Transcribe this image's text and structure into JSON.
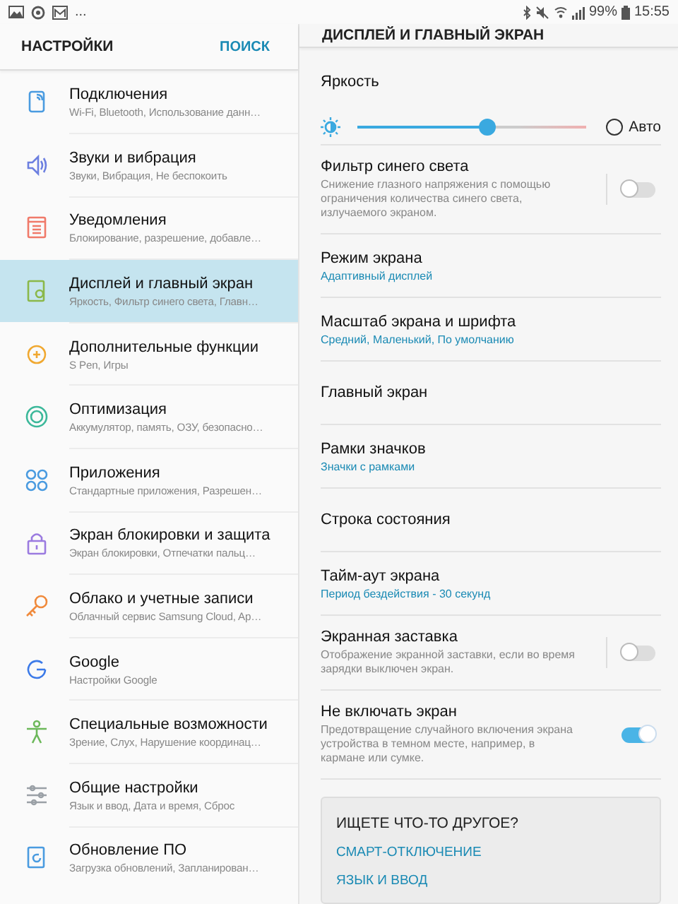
{
  "status_bar": {
    "more": "...",
    "battery": "99%",
    "time": "15:55"
  },
  "sidebar": {
    "title": "НАСТРОЙКИ",
    "search": "ПОИСК",
    "items": [
      {
        "title": "Подключения",
        "subtitle": "Wi-Fi, Bluetooth, Использование данн…",
        "selected": false
      },
      {
        "title": "Звуки и вибрация",
        "subtitle": "Звуки, Вибрация, Не беспокоить",
        "selected": false
      },
      {
        "title": "Уведомления",
        "subtitle": "Блокирование, разрешение, добавле…",
        "selected": false
      },
      {
        "title": "Дисплей и главный экран",
        "subtitle": "Яркость, Фильтр синего света, Главн…",
        "selected": true
      },
      {
        "title": "Дополнительные функции",
        "subtitle": "S Pen, Игры",
        "selected": false
      },
      {
        "title": "Оптимизация",
        "subtitle": "Аккумулятор, память, ОЗУ, безопасно…",
        "selected": false
      },
      {
        "title": "Приложения",
        "subtitle": "Стандартные приложения, Разрешен…",
        "selected": false
      },
      {
        "title": "Экран блокировки и защита",
        "subtitle": "Экран блокировки, Отпечатки пальц…",
        "selected": false
      },
      {
        "title": "Облако и учетные записи",
        "subtitle": "Облачный сервис Samsung Cloud, Ap…",
        "selected": false
      },
      {
        "title": "Google",
        "subtitle": "Настройки Google",
        "selected": false
      },
      {
        "title": "Специальные возможности",
        "subtitle": "Зрение, Слух, Нарушение координац…",
        "selected": false
      },
      {
        "title": "Общие настройки",
        "subtitle": "Язык и ввод, Дата и время, Сброс",
        "selected": false
      },
      {
        "title": "Обновление ПО",
        "subtitle": "Загрузка обновлений, Запланирован…",
        "selected": false
      }
    ]
  },
  "detail": {
    "title": "ДИСПЛЕЙ И ГЛАВНЫЙ ЭКРАН",
    "brightness": {
      "label": "Яркость",
      "level": 0.57,
      "auto_label": "Авто",
      "auto": false
    },
    "items": [
      {
        "kind": "toggle",
        "title": "Фильтр синего света",
        "description": "Снижение глазного напряжения с помощью ограничения количества синего света, излучаемого экраном.",
        "on": false,
        "split": true
      },
      {
        "kind": "text",
        "title": "Режим экрана",
        "value": "Адаптивный дисплей"
      },
      {
        "kind": "text",
        "title": "Масштаб экрана и шрифта",
        "value": "Средний, Маленький, По умолчанию"
      },
      {
        "kind": "text",
        "title": "Главный экран"
      },
      {
        "kind": "text",
        "title": "Рамки значков",
        "value": "Значки с рамками"
      },
      {
        "kind": "text",
        "title": "Строка состояния"
      },
      {
        "kind": "text",
        "title": "Тайм-аут экрана",
        "value": "Период бездействия - 30 секунд"
      },
      {
        "kind": "toggle",
        "title": "Экранная заставка",
        "description": "Отображение экранной заставки, если во время зарядки выключен экран.",
        "on": false,
        "split": true
      },
      {
        "kind": "toggle",
        "title": "Не включать экран",
        "description": "Предотвращение случайного включения экрана устройства в темном месте, например, в кармане или сумке.",
        "on": true,
        "split": false
      }
    ],
    "suggest": {
      "title": "ИЩЕТЕ ЧТО-ТО ДРУГОЕ?",
      "links": [
        "СМАРТ-ОТКЛЮЧЕНИЕ",
        "ЯЗЫК И ВВОД"
      ]
    }
  }
}
